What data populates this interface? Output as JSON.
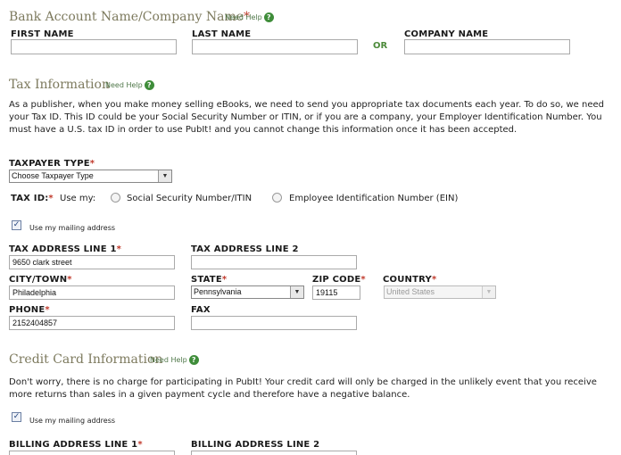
{
  "bank": {
    "title": "Bank Account Name/Company Name",
    "req": "*",
    "help": "Need Help",
    "first_name_label": "FIRST NAME",
    "last_name_label": "LAST NAME",
    "or_label": "OR",
    "company_name_label": "COMPANY NAME",
    "first_name_value": "",
    "last_name_value": "",
    "company_name_value": ""
  },
  "tax": {
    "title": "Tax Information",
    "help": "Need Help",
    "description": "As a publisher, when you make money selling eBooks, we need to send you appropriate tax documents each year. To do so, we need your Tax ID. This ID could be your Social Security Number or ITIN, or if you are a company, your Employer Identification Number. You must have a U.S. tax ID in order to use PubIt! and you cannot change this information once it has been accepted.",
    "taxpayer_type_label": "TAXPAYER TYPE",
    "taxpayer_type_value": "Choose Taxpayer Type",
    "tax_id_label": "TAX ID:",
    "use_my": "Use my:",
    "option_ssn": "Social Security Number/ITIN",
    "option_ein": "Employee Identification Number (EIN)",
    "use_mailing": "Use my mailing address",
    "line1_label": "TAX ADDRESS LINE 1",
    "line1_value": "9650 clark street",
    "line2_label": "TAX ADDRESS LINE 2",
    "line2_value": "",
    "city_label": "CITY/TOWN",
    "city_value": "Philadelphia",
    "state_label": "STATE",
    "state_value": "Pennsylvania",
    "zip_label": "ZIP CODE",
    "zip_value": "19115",
    "country_label": "COUNTRY",
    "country_value": "United States",
    "phone_label": "PHONE",
    "phone_value": "2152404857",
    "fax_label": "FAX",
    "fax_value": ""
  },
  "card": {
    "title": "Credit Card Information",
    "help": "Need Help",
    "description": "Don't worry, there is no charge for participating in PubIt! Your credit card will only be charged in the unlikely event that you receive more returns than sales in a given payment cycle and therefore have a negative balance.",
    "use_mailing": "Use my mailing address",
    "billing1_label": "BILLING ADDRESS LINE 1",
    "billing2_label": "BILLING ADDRESS LINE 2"
  },
  "common": {
    "req": "*",
    "check": "✓",
    "help_q": "?",
    "arrow": "▼"
  },
  "colors": {
    "section_title": "#7d7a5e",
    "required": "#c0392b",
    "help_green": "#3f8d3a"
  }
}
